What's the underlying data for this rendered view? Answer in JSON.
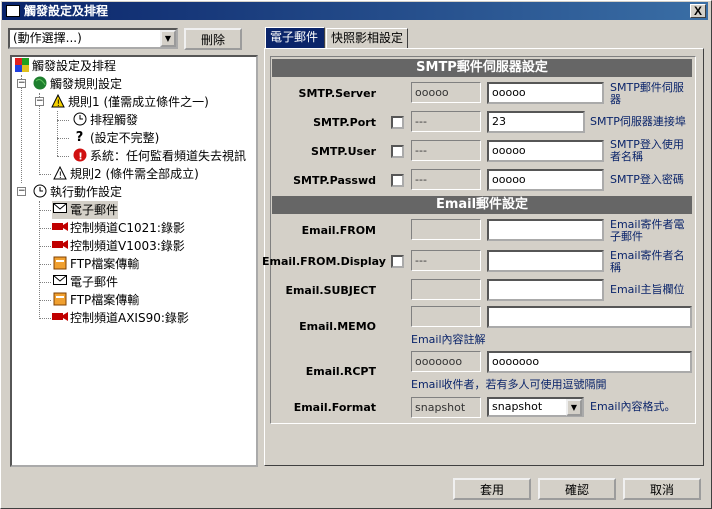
{
  "window": {
    "title": "觸發設定及排程",
    "close_glyph": "X"
  },
  "toolbar": {
    "action_select": "(動作選擇...)",
    "delete_label": "刪除"
  },
  "tree": {
    "root": "觸發設定及排程",
    "rules_group": "觸發規則設定",
    "rule1": "規則1 (僅需成立條件之一)",
    "rule1_schedule": "排程觸發",
    "rule1_incomplete": "(設定不完整)",
    "rule1_system": "系統：任何監看頻道失去視訊",
    "rule2": "規則2 (條件需全部成立)",
    "actions_group": "執行動作設定",
    "actions": [
      "電子郵件",
      "控制頻道C1021:錄影",
      "控制頻道V1003:錄影",
      "FTP檔案傳輸",
      "電子郵件",
      "FTP檔案傳輸",
      "控制頻道AXIS90:錄影"
    ]
  },
  "tabs": [
    "電子郵件",
    "快照影相設定"
  ],
  "smtp": {
    "header": "SMTP郵件伺服器設定",
    "rows": [
      {
        "label": "SMTP.Server",
        "ro": "ooooo",
        "value": "ooooo",
        "desc": "SMTP郵件伺服器"
      },
      {
        "label": "SMTP.Port",
        "ro": "---",
        "value": "23",
        "desc": "SMTP伺服器連接埠"
      },
      {
        "label": "SMTP.User",
        "ro": "---",
        "value": "ooooo",
        "desc": "SMTP登入使用者名稱"
      },
      {
        "label": "SMTP.Passwd",
        "ro": "---",
        "value": "ooooo",
        "desc": "SMTP登入密碼"
      }
    ]
  },
  "email": {
    "header": "Email郵件設定",
    "from_label": "Email.FROM",
    "from_desc": "Email寄件者電子郵件",
    "fromdisp_label": "Email.FROM.Display",
    "fromdisp_ro": "---",
    "fromdisp_desc": "Email寄件者名稱",
    "subject_label": "Email.SUBJECT",
    "subject_desc": "Email主旨欄位",
    "memo_label": "Email.MEMO",
    "memo_desc": "Email內容註解",
    "rcpt_label": "Email.RCPT",
    "rcpt_ro": "ooooooo",
    "rcpt_value": "ooooooo",
    "rcpt_desc": "Email收件者，若有多人可使用逗號隔開",
    "format_label": "Email.Format",
    "format_ro": "snapshot",
    "format_value": "snapshot",
    "format_desc": "Email內容格式。"
  },
  "footer": {
    "apply": "套用",
    "ok": "確認",
    "cancel": "取消"
  }
}
